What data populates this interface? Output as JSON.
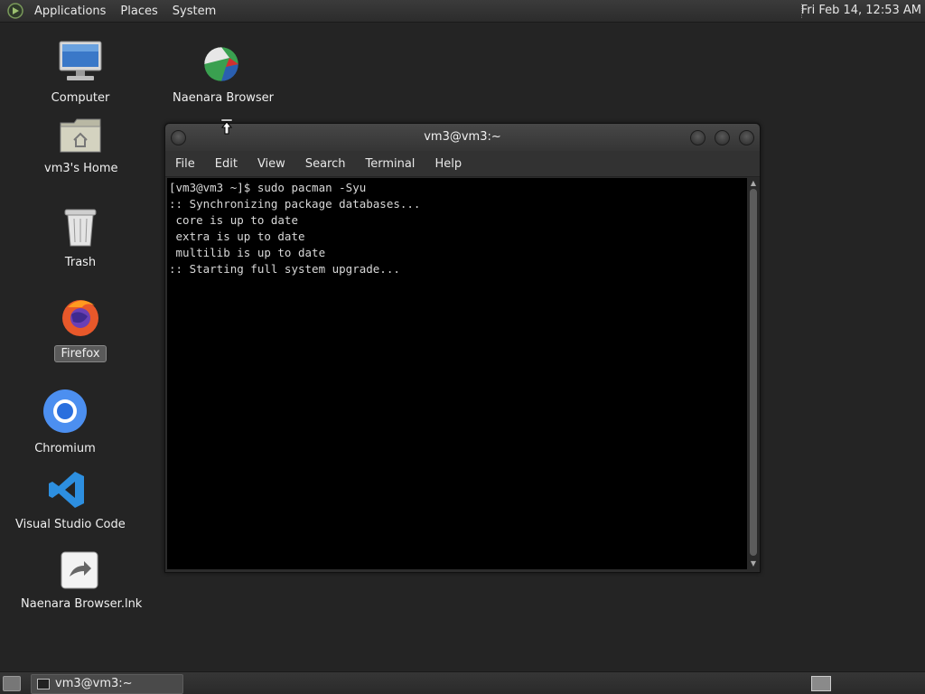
{
  "top_panel": {
    "menus": [
      "Applications",
      "Places",
      "System"
    ],
    "clock": "Fri Feb 14, 12:53 AM"
  },
  "desktop_icons": {
    "computer": "Computer",
    "naenara": "Naenara Browser",
    "home": "vm3's Home",
    "trash": "Trash",
    "firefox": "Firefox",
    "chromium": "Chromium",
    "vscode": "Visual Studio Code",
    "naenara_lnk": "Naenara Browser.lnk"
  },
  "terminal": {
    "title": "vm3@vm3:~",
    "menu": [
      "File",
      "Edit",
      "View",
      "Search",
      "Terminal",
      "Help"
    ],
    "lines": [
      "[vm3@vm3 ~]$ sudo pacman -Syu",
      ":: Synchronizing package databases...",
      " core is up to date",
      " extra is up to date",
      " multilib is up to date",
      ":: Starting full system upgrade..."
    ]
  },
  "taskbar": {
    "task_label": "vm3@vm3:~"
  }
}
